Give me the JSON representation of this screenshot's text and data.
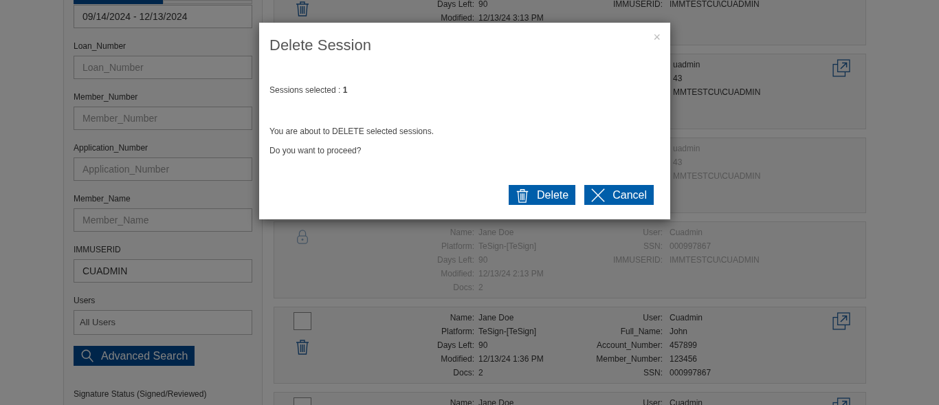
{
  "sidebar": {
    "tabs": [
      {
        "selected": true
      },
      {
        "selected": false
      }
    ],
    "date_range": {
      "value": "09/14/2024 - 12/13/2024"
    },
    "fields": [
      {
        "label": "Loan_Number",
        "placeholder": "Loan_Number"
      },
      {
        "label": "Member_Number",
        "placeholder": "Member_Number"
      },
      {
        "label": "Application_Number",
        "placeholder": "Application_Number"
      },
      {
        "label": "Member_Name",
        "placeholder": "Member_Name"
      },
      {
        "label": "IMMUSERID",
        "value": "CUADMIN"
      }
    ],
    "users": {
      "label": "Users",
      "value": "All Users"
    },
    "search_button": "Advanced Search",
    "section_label": "Signature Status (Signed/Reviewed)"
  },
  "sessions": [
    {
      "disabled": false,
      "icons": [
        {
          "kind": "trash"
        }
      ],
      "left": [
        {
          "label": "Days Left:",
          "value": "90"
        },
        {
          "label": "Modified:",
          "value": "12/13/24 3:13 PM"
        }
      ],
      "right": [
        {
          "label": "IMMUSERID:",
          "value": "IMMTESTCU\\CUADMIN"
        }
      ],
      "expand": false
    },
    {
      "disabled": false,
      "right": [
        {
          "value": "uadmin"
        },
        {
          "value": "43"
        },
        {
          "value": "MMTESTCU\\CUADMIN"
        }
      ],
      "expand": true
    },
    {
      "disabled": true,
      "right": [
        {
          "value": "uadmin"
        },
        {
          "value": "43"
        },
        {
          "value": "MMTESTCU\\CUADMIN"
        }
      ],
      "expand": false
    },
    {
      "disabled": true,
      "icons": [
        {
          "kind": "lock"
        }
      ],
      "left": [
        {
          "label": "Name:",
          "value": "Jane Doe"
        },
        {
          "label": "Platform:",
          "value": "TeSign-[TeSign]"
        },
        {
          "label": "Days Left:",
          "value": "90"
        },
        {
          "label": "Modified:",
          "value": "12/13/24 2:13 PM"
        },
        {
          "label": "Docs:",
          "value": "2"
        }
      ],
      "right": [
        {
          "label": "User:",
          "value": "Cuadmin"
        },
        {
          "label": "SSN:",
          "value": "000997867"
        },
        {
          "label": "IMMUSERID:",
          "value": "IMMTESTCU\\CUADMIN"
        }
      ],
      "expand": false
    },
    {
      "disabled": false,
      "icons": [
        {
          "kind": "checkbox",
          "checked": false
        },
        {
          "kind": "trash"
        }
      ],
      "left": [
        {
          "label": "Name:",
          "value": "Jane Doe"
        },
        {
          "label": "Platform:",
          "value": "TeSign-[TeSign]"
        },
        {
          "label": "Days Left:",
          "value": "90"
        },
        {
          "label": "Modified:",
          "value": "12/13/24 1:36 PM"
        },
        {
          "label": "Docs:",
          "value": "2"
        }
      ],
      "right": [
        {
          "label": "User:",
          "value": "Cuadmin"
        },
        {
          "label": "Full_Name:",
          "value": "John"
        },
        {
          "label": "Account_Number:",
          "value": "457899"
        },
        {
          "label": "Member_Number:",
          "value": "123456"
        },
        {
          "label": "SSN:",
          "value": "000997867"
        }
      ],
      "expand": true
    },
    {
      "disabled": false,
      "icons": [
        {
          "kind": "checkbox",
          "checked": false
        }
      ],
      "left": [
        {
          "label": "Name:",
          "value": "Jane Doe"
        }
      ],
      "right": [
        {
          "label": "User:",
          "value": "Cuadmin"
        }
      ],
      "expand": true
    }
  ],
  "modal": {
    "title": "Delete Session",
    "close": "×",
    "selected_label": "Sessions selected : ",
    "selected_count": "1",
    "message": "You are about to DELETE selected sessions.",
    "question": "Do you want to proceed?",
    "buttons": [
      {
        "kind": "delete",
        "label": "Delete"
      },
      {
        "kind": "cancel",
        "label": "Cancel"
      }
    ]
  }
}
